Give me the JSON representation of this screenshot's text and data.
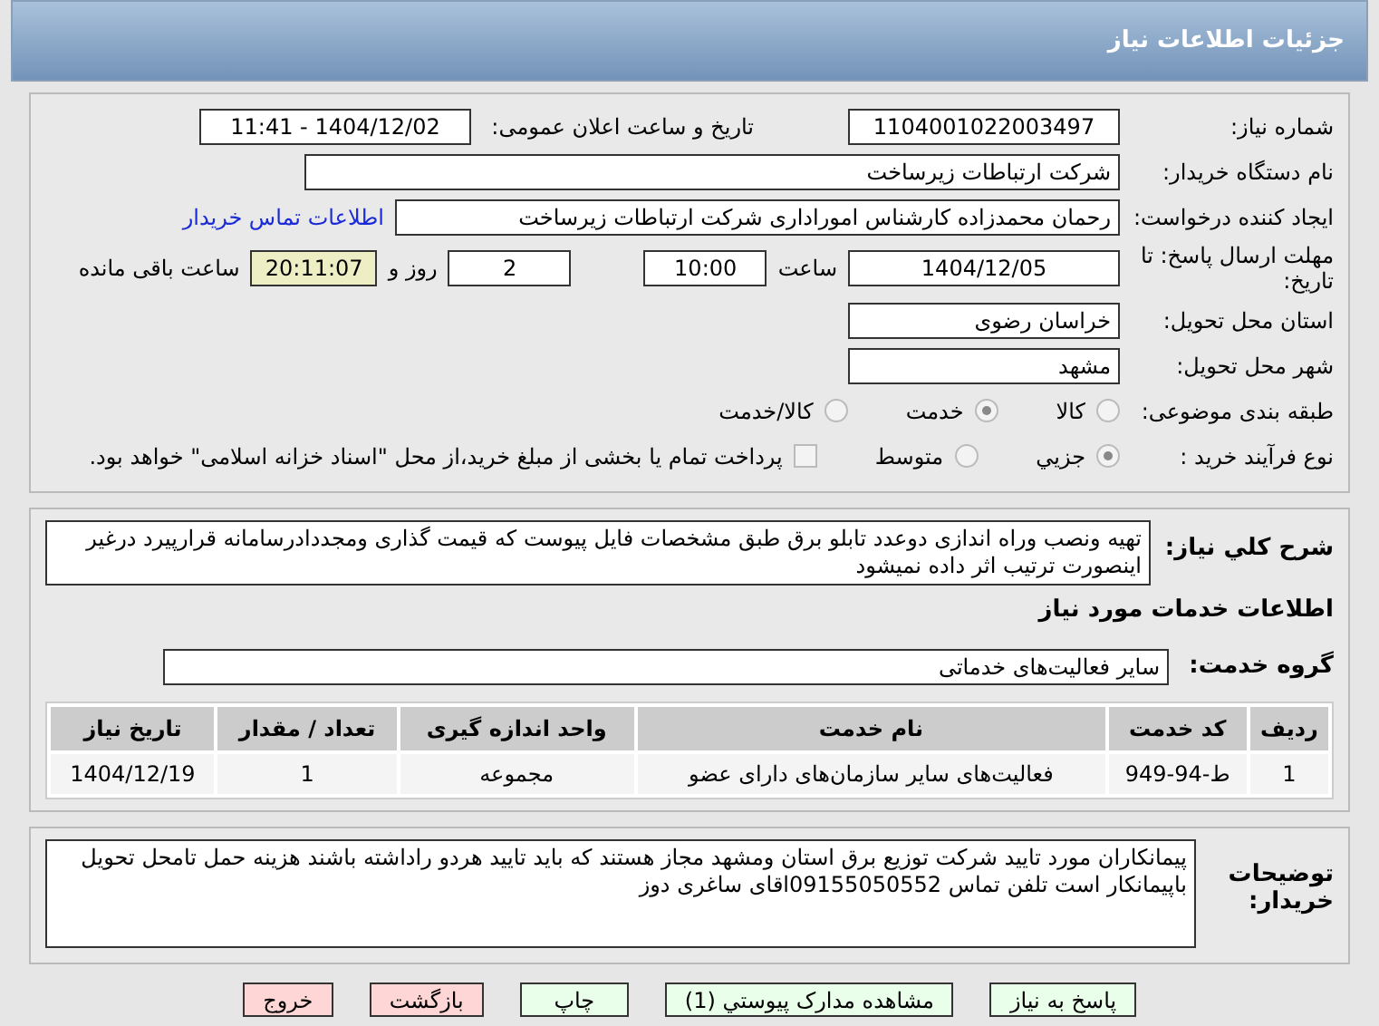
{
  "header": {
    "title": "جزئیات اطلاعات نیاز"
  },
  "info": {
    "need_number_label": "شماره نیاز:",
    "need_number": "1104001022003497",
    "announce_label": "تاریخ و ساعت اعلان عمومی:",
    "announce_value": "1404/12/02 - 11:41",
    "buyer_label": "نام دستگاه خریدار:",
    "buyer": "شرکت ارتباطات زیرساخت",
    "creator_label": "ایجاد کننده درخواست:",
    "creator": "رحمان محمدزاده کارشناس اموراداری  شرکت ارتباطات زیرساخت",
    "contact_link": "اطلاعات تماس خریدار",
    "deadline_label": "مهلت ارسال پاسخ: تا تاریخ:",
    "deadline_date": "1404/12/05",
    "time_label": "ساعت",
    "deadline_time": "10:00",
    "days": "2",
    "days_label": "روز و",
    "remaining": "20:11:07",
    "remaining_label": "ساعت باقی مانده",
    "province_label": "استان محل تحویل:",
    "province": "خراسان رضوی",
    "city_label": "شهر محل تحویل:",
    "city": "مشهد",
    "category_label": "طبقه بندی موضوعی:",
    "category_options": [
      {
        "label": "كالا",
        "selected": false
      },
      {
        "label": "خدمت",
        "selected": true
      },
      {
        "label": "كالا/خدمت",
        "selected": false
      }
    ],
    "process_label": "نوع فرآیند خرید :",
    "process_options": [
      {
        "label": "جزیي",
        "selected": true
      },
      {
        "label": "متوسط",
        "selected": false
      }
    ],
    "payment_checked": false,
    "payment_text": "پرداخت تمام یا بخشی از مبلغ خرید،از محل \"اسناد خزانه اسلامی\" خواهد بود."
  },
  "summary": {
    "label": "شرح كلي نیاز:",
    "text": "تهیه ونصب وراه اندازی دوعدد تابلو برق طبق مشخصات فایل پیوست که قیمت گذاری ومجددادرسامانه قرارپیرد درغیر اینصورت ترتیب اثر داده نمیشود"
  },
  "services": {
    "title": "اطلاعات خدمات مورد نیاز",
    "group_label": "گروه خدمت:",
    "group": "سایر فعالیت‌های خدماتی",
    "table": {
      "columns": [
        "ردیف",
        "کد خدمت",
        "نام خدمت",
        "واحد اندازه گیری",
        "تعداد / مقدار",
        "تاریخ نیاز"
      ],
      "rows": [
        [
          "1",
          "ط-94-949",
          "فعالیت‌های سایر سازمان‌های دارای عضو",
          "مجموعه",
          "1",
          "1404/12/19"
        ]
      ]
    }
  },
  "notes": {
    "label": "توضیحات خریدار:",
    "text": "پیمانکاران مورد تایید شرکت توزیع برق استان ومشهد مجاز هستند که باید تایید هردو راداشته باشند هزینه حمل تامحل تحویل باپیمانکار است   تلفن تماس 09155050552اقای ساغری دوز"
  },
  "buttons": [
    {
      "label": "پاسخ به نیاز",
      "kind": "action"
    },
    {
      "label": "مشاهده مدارک پیوستي (1)",
      "kind": "action"
    },
    {
      "label": "چاپ",
      "kind": "action"
    },
    {
      "label": "بازگشت",
      "kind": "exit"
    },
    {
      "label": "خروج",
      "kind": "exit"
    }
  ]
}
